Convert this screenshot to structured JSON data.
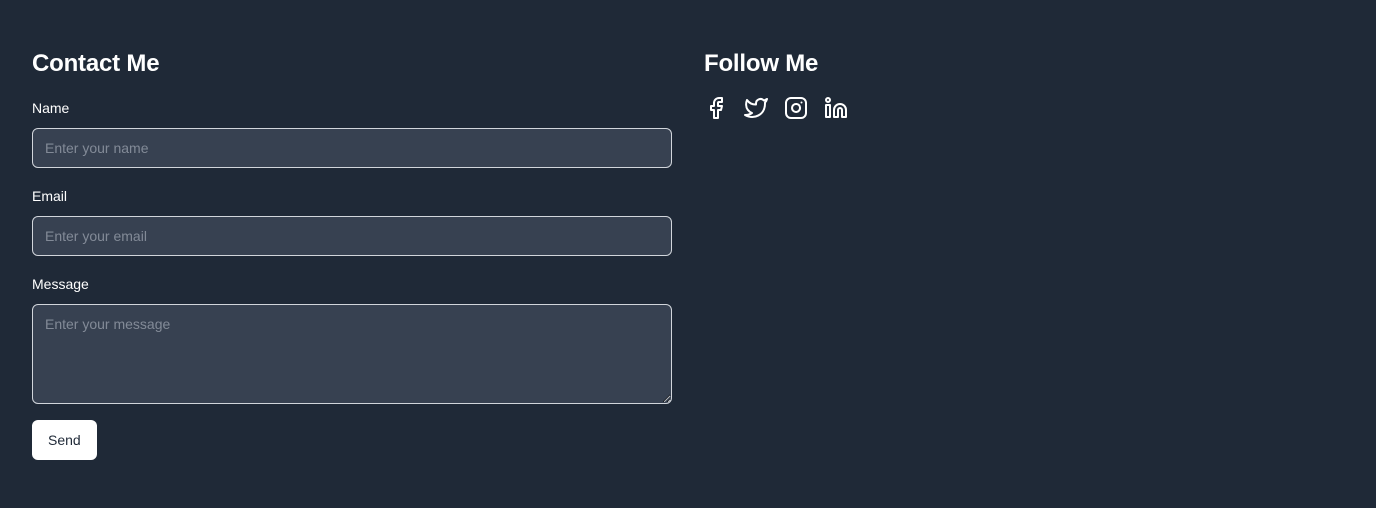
{
  "contact": {
    "title": "Contact Me",
    "name_label": "Name",
    "name_placeholder": "Enter your name",
    "name_value": "",
    "email_label": "Email",
    "email_placeholder": "Enter your email",
    "email_value": "",
    "message_label": "Message",
    "message_placeholder": "Enter your message",
    "message_value": "",
    "send_label": "Send"
  },
  "follow": {
    "title": "Follow Me",
    "icons": [
      "facebook-icon",
      "twitter-icon",
      "instagram-icon",
      "linkedin-icon"
    ]
  },
  "colors": {
    "background": "#1f2937",
    "input_background": "#374151",
    "input_border": "#d1d5db",
    "text": "#ffffff",
    "button_background": "#ffffff",
    "button_text": "#1f2937"
  }
}
